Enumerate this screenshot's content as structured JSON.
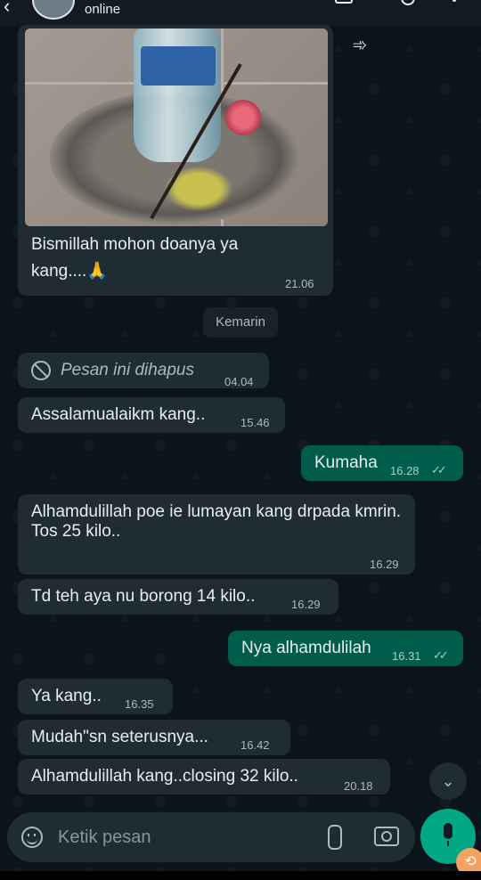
{
  "header": {
    "status": "online"
  },
  "photo_message": {
    "caption": "Bismillah mohon doanya ya kang....🙏",
    "time": "21.06"
  },
  "day_divider": "Kemarin",
  "messages": [
    {
      "dir": "in",
      "deleted": true,
      "text": "Pesan ini dihapus",
      "time": "04.04"
    },
    {
      "dir": "in",
      "text": "Assalamualaikm kang..",
      "time": "15.46"
    },
    {
      "dir": "out",
      "text": "Kumaha",
      "time": "16.28"
    },
    {
      "dir": "in",
      "text": "Alhamdulillah poe ie lumayan kang drpada kmrin.\nTos 25 kilo..",
      "time": "16.29"
    },
    {
      "dir": "in",
      "text": "Td teh aya nu borong 14 kilo..",
      "time": "16.29"
    },
    {
      "dir": "out",
      "text": "Nya alhamdulilah",
      "time": "16.31"
    },
    {
      "dir": "in",
      "text": "Ya kang..",
      "time": "16.35"
    },
    {
      "dir": "in",
      "text": "Mudah\"sn seterusnya...",
      "time": "16.42"
    },
    {
      "dir": "in",
      "text": "Alhamdulillah kang..closing 32 kilo..",
      "time": "20.18"
    }
  ],
  "composer": {
    "placeholder": "Ketik pesan"
  },
  "colors": {
    "background": "#0b141a",
    "incoming": "#202c33",
    "outgoing": "#005c4b",
    "accent": "#00a884"
  },
  "icons": [
    "back-icon",
    "video-call-icon",
    "voice-call-icon",
    "menu-icon",
    "forward-icon",
    "deleted-icon",
    "read-ticks-icon",
    "emoji-icon",
    "attach-icon",
    "camera-icon",
    "mic-icon",
    "scroll-down-icon"
  ]
}
